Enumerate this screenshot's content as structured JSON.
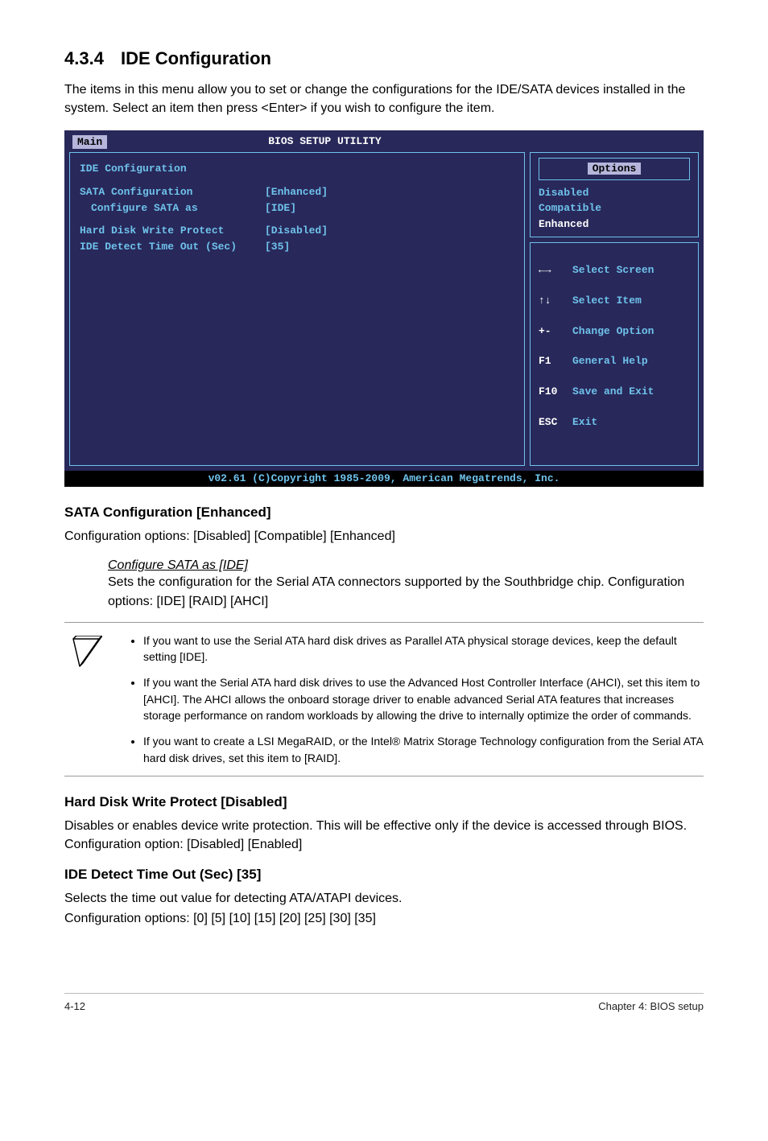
{
  "heading": {
    "num": "4.3.4",
    "title": "IDE Configuration"
  },
  "intro": "The items in this menu allow you to set or change the configurations for the IDE/SATA devices installed in the system. Select an item then press <Enter> if you wish to configure the item.",
  "bios": {
    "tab": "Main",
    "title": "BIOS SETUP UTILITY",
    "left_title": "IDE Configuration",
    "rows": [
      {
        "label": "SATA Configuration",
        "value": "[Enhanced]",
        "indent": false
      },
      {
        "label": "Configure SATA as",
        "value": "[IDE]",
        "indent": true
      },
      {
        "label": "Hard Disk Write Protect",
        "value": "[Disabled]",
        "indent": false
      },
      {
        "label": "IDE Detect Time Out (Sec)",
        "value": "[35]",
        "indent": false
      }
    ],
    "options_title": "Options",
    "options": [
      "Disabled",
      "Compatible",
      "Enhanced"
    ],
    "options_highlight_index": 2,
    "nav": [
      {
        "key": "←→",
        "label": "Select Screen"
      },
      {
        "key": "↑↓",
        "label": "Select Item"
      },
      {
        "key": "+-",
        "label": "Change Option"
      },
      {
        "key": "F1",
        "label": "General Help"
      },
      {
        "key": "F10",
        "label": "Save and Exit"
      },
      {
        "key": "ESC",
        "label": "Exit"
      }
    ],
    "footer": "v02.61 (C)Copyright 1985-2009, American Megatrends, Inc."
  },
  "sata": {
    "head": "SATA Configuration [Enhanced]",
    "body": "Configuration options: [Disabled] [Compatible] [Enhanced]",
    "sub_title": "Configure SATA as [IDE]",
    "sub_body": "Sets the configuration for the Serial ATA connectors supported by the Southbridge chip. Configuration options: [IDE] [RAID] [AHCI]"
  },
  "tips": [
    "If you want to use the Serial ATA hard disk drives as Parallel ATA physical storage devices, keep the default setting [IDE].",
    "If you want the Serial ATA hard disk drives to use the Advanced Host Controller Interface (AHCI), set this item to [AHCI]. The AHCI allows the onboard storage driver to enable advanced Serial ATA features that increases storage performance on random workloads by allowing the drive to internally optimize the order of commands.",
    "If you want to create a LSI MegaRAID, or the Intel® Matrix Storage Technology configuration from the Serial ATA hard disk drives, set this item to [RAID]."
  ],
  "hdwp": {
    "head": "Hard Disk Write Protect [Disabled]",
    "body": "Disables or enables device write protection. This will be effective only if the device is accessed through BIOS. Configuration option: [Disabled] [Enabled]"
  },
  "ide_to": {
    "head": "IDE Detect Time Out (Sec) [35]",
    "body1": "Selects the time out value for detecting ATA/ATAPI devices.",
    "body2": "Configuration options: [0] [5] [10] [15] [20] [25] [30] [35]"
  },
  "footer": {
    "left": "4-12",
    "right": "Chapter 4: BIOS setup"
  }
}
